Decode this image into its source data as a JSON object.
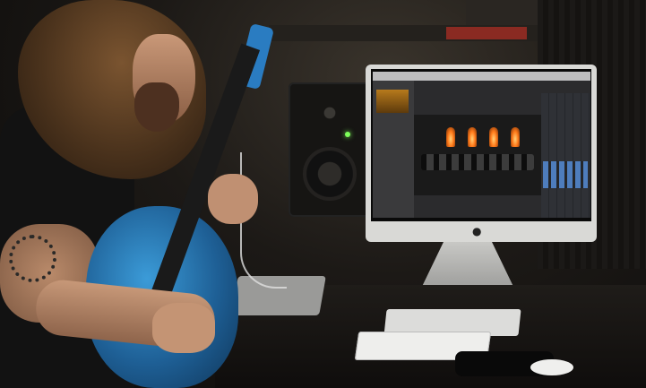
{
  "scene": {
    "brand_logo_text": "",
    "screen_label": ""
  },
  "colors": {
    "guitar": "#2a7cc1",
    "screen_accent": "#ff7a1a",
    "led": "#7dff5a"
  }
}
